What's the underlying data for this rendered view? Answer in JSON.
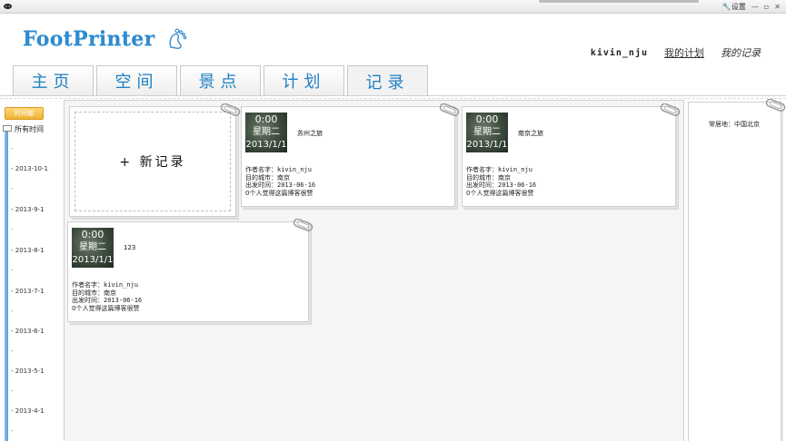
{
  "window": {
    "settings_label": "设置",
    "min_btn": "—",
    "restore_btn": "▫",
    "close_btn": "✕"
  },
  "header": {
    "logo_text": "FootPrinter",
    "username": "kivin_nju",
    "my_plans": "我的计划",
    "my_records": "我的记录"
  },
  "tabs": [
    {
      "label": "主页"
    },
    {
      "label": "空间"
    },
    {
      "label": "景点"
    },
    {
      "label": "计划"
    },
    {
      "label": "记录"
    }
  ],
  "timeline": {
    "badge": "时间轴",
    "all_time": "所有时间",
    "months": [
      "2013-10-1",
      "2013-9-1",
      "2013-8-1",
      "2013-7-1",
      "2013-6-1",
      "2013-5-1",
      "2013-4-1"
    ]
  },
  "new_record": {
    "label": "+ 新记录"
  },
  "records": [
    {
      "time": "0:00",
      "weekday": "星期二",
      "date": "2013/1/1",
      "title": "苏州之旅",
      "author_label": "作者名字：",
      "author": "kivin_nju",
      "city_label": "目的城市：",
      "city": "南京",
      "depart_label": "出发时间：",
      "depart": "2013-06-16",
      "likes_text": "0个人觉得这篇博客很赞"
    },
    {
      "time": "0:00",
      "weekday": "星期二",
      "date": "2013/1/1",
      "title": "南京之旅",
      "author_label": "作者名字：",
      "author": "kivin_nju",
      "city_label": "目的城市：",
      "city": "南京",
      "depart_label": "出发时间：",
      "depart": "2013-06-16",
      "likes_text": "0个人觉得这篇博客很赞"
    },
    {
      "time": "0:00",
      "weekday": "星期二",
      "date": "2013/1/1",
      "title": "123",
      "author_label": "作者名字：",
      "author": "kivin_nju",
      "city_label": "目的城市：",
      "city": "南京",
      "depart_label": "出发时间：",
      "depart": "2013-06-16",
      "likes_text": "0个人觉得这篇博客很赞"
    }
  ],
  "side": {
    "residence": "常居地：中国北京"
  }
}
